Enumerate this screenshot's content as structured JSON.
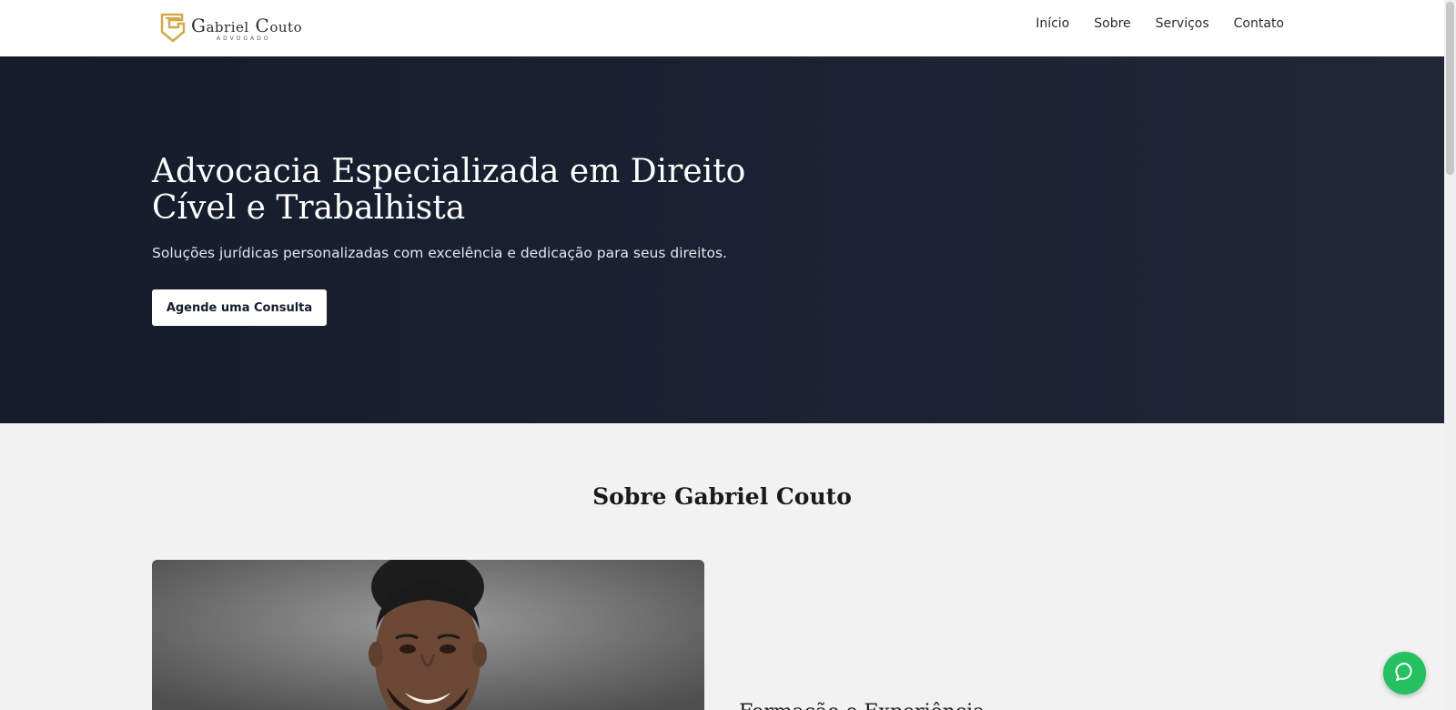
{
  "header": {
    "logo": {
      "name_initial_1": "G",
      "name_rest_1": "abriel",
      "name_initial_2": "C",
      "name_rest_2": "outo",
      "subtitle": "ADVOGADO",
      "icon": "gc-monogram-logo",
      "accent": "#d4a74a"
    },
    "nav": [
      "Início",
      "Sobre",
      "Serviços",
      "Contato"
    ]
  },
  "hero": {
    "title": "Advocacia Especializada em Direito Cível e Trabalhista",
    "subtitle": "Soluções jurídicas personalizadas com excelência e dedicação para seus direitos.",
    "cta_label": "Agende uma Consulta",
    "background": "#1b2233"
  },
  "about": {
    "title": "Sobre Gabriel Couto",
    "photo_alt": "Gabriel Couto",
    "next_heading_peek": "Formação e Experiência"
  },
  "chat": {
    "icon": "chat-bubble-icon",
    "color": "#25c060"
  }
}
